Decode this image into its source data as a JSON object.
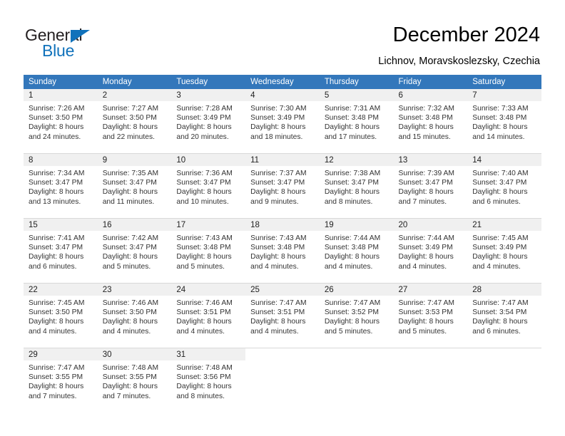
{
  "brand": {
    "name_part1": "General",
    "name_part2": "Blue",
    "triangle_icon": "blue-triangle-icon",
    "accent_color": "#1072bb"
  },
  "header": {
    "title": "December 2024",
    "subtitle": "Lichnov, Moravskoslezsky, Czechia"
  },
  "calendar": {
    "header_bg": "#3377bb",
    "daynum_bg": "#f0f0f0",
    "weekdays": [
      "Sunday",
      "Monday",
      "Tuesday",
      "Wednesday",
      "Thursday",
      "Friday",
      "Saturday"
    ],
    "weeks": [
      [
        {
          "day": "1",
          "sunrise": "Sunrise: 7:26 AM",
          "sunset": "Sunset: 3:50 PM",
          "daylight1": "Daylight: 8 hours",
          "daylight2": "and 24 minutes."
        },
        {
          "day": "2",
          "sunrise": "Sunrise: 7:27 AM",
          "sunset": "Sunset: 3:50 PM",
          "daylight1": "Daylight: 8 hours",
          "daylight2": "and 22 minutes."
        },
        {
          "day": "3",
          "sunrise": "Sunrise: 7:28 AM",
          "sunset": "Sunset: 3:49 PM",
          "daylight1": "Daylight: 8 hours",
          "daylight2": "and 20 minutes."
        },
        {
          "day": "4",
          "sunrise": "Sunrise: 7:30 AM",
          "sunset": "Sunset: 3:49 PM",
          "daylight1": "Daylight: 8 hours",
          "daylight2": "and 18 minutes."
        },
        {
          "day": "5",
          "sunrise": "Sunrise: 7:31 AM",
          "sunset": "Sunset: 3:48 PM",
          "daylight1": "Daylight: 8 hours",
          "daylight2": "and 17 minutes."
        },
        {
          "day": "6",
          "sunrise": "Sunrise: 7:32 AM",
          "sunset": "Sunset: 3:48 PM",
          "daylight1": "Daylight: 8 hours",
          "daylight2": "and 15 minutes."
        },
        {
          "day": "7",
          "sunrise": "Sunrise: 7:33 AM",
          "sunset": "Sunset: 3:48 PM",
          "daylight1": "Daylight: 8 hours",
          "daylight2": "and 14 minutes."
        }
      ],
      [
        {
          "day": "8",
          "sunrise": "Sunrise: 7:34 AM",
          "sunset": "Sunset: 3:47 PM",
          "daylight1": "Daylight: 8 hours",
          "daylight2": "and 13 minutes."
        },
        {
          "day": "9",
          "sunrise": "Sunrise: 7:35 AM",
          "sunset": "Sunset: 3:47 PM",
          "daylight1": "Daylight: 8 hours",
          "daylight2": "and 11 minutes."
        },
        {
          "day": "10",
          "sunrise": "Sunrise: 7:36 AM",
          "sunset": "Sunset: 3:47 PM",
          "daylight1": "Daylight: 8 hours",
          "daylight2": "and 10 minutes."
        },
        {
          "day": "11",
          "sunrise": "Sunrise: 7:37 AM",
          "sunset": "Sunset: 3:47 PM",
          "daylight1": "Daylight: 8 hours",
          "daylight2": "and 9 minutes."
        },
        {
          "day": "12",
          "sunrise": "Sunrise: 7:38 AM",
          "sunset": "Sunset: 3:47 PM",
          "daylight1": "Daylight: 8 hours",
          "daylight2": "and 8 minutes."
        },
        {
          "day": "13",
          "sunrise": "Sunrise: 7:39 AM",
          "sunset": "Sunset: 3:47 PM",
          "daylight1": "Daylight: 8 hours",
          "daylight2": "and 7 minutes."
        },
        {
          "day": "14",
          "sunrise": "Sunrise: 7:40 AM",
          "sunset": "Sunset: 3:47 PM",
          "daylight1": "Daylight: 8 hours",
          "daylight2": "and 6 minutes."
        }
      ],
      [
        {
          "day": "15",
          "sunrise": "Sunrise: 7:41 AM",
          "sunset": "Sunset: 3:47 PM",
          "daylight1": "Daylight: 8 hours",
          "daylight2": "and 6 minutes."
        },
        {
          "day": "16",
          "sunrise": "Sunrise: 7:42 AM",
          "sunset": "Sunset: 3:47 PM",
          "daylight1": "Daylight: 8 hours",
          "daylight2": "and 5 minutes."
        },
        {
          "day": "17",
          "sunrise": "Sunrise: 7:43 AM",
          "sunset": "Sunset: 3:48 PM",
          "daylight1": "Daylight: 8 hours",
          "daylight2": "and 5 minutes."
        },
        {
          "day": "18",
          "sunrise": "Sunrise: 7:43 AM",
          "sunset": "Sunset: 3:48 PM",
          "daylight1": "Daylight: 8 hours",
          "daylight2": "and 4 minutes."
        },
        {
          "day": "19",
          "sunrise": "Sunrise: 7:44 AM",
          "sunset": "Sunset: 3:48 PM",
          "daylight1": "Daylight: 8 hours",
          "daylight2": "and 4 minutes."
        },
        {
          "day": "20",
          "sunrise": "Sunrise: 7:44 AM",
          "sunset": "Sunset: 3:49 PM",
          "daylight1": "Daylight: 8 hours",
          "daylight2": "and 4 minutes."
        },
        {
          "day": "21",
          "sunrise": "Sunrise: 7:45 AM",
          "sunset": "Sunset: 3:49 PM",
          "daylight1": "Daylight: 8 hours",
          "daylight2": "and 4 minutes."
        }
      ],
      [
        {
          "day": "22",
          "sunrise": "Sunrise: 7:45 AM",
          "sunset": "Sunset: 3:50 PM",
          "daylight1": "Daylight: 8 hours",
          "daylight2": "and 4 minutes."
        },
        {
          "day": "23",
          "sunrise": "Sunrise: 7:46 AM",
          "sunset": "Sunset: 3:50 PM",
          "daylight1": "Daylight: 8 hours",
          "daylight2": "and 4 minutes."
        },
        {
          "day": "24",
          "sunrise": "Sunrise: 7:46 AM",
          "sunset": "Sunset: 3:51 PM",
          "daylight1": "Daylight: 8 hours",
          "daylight2": "and 4 minutes."
        },
        {
          "day": "25",
          "sunrise": "Sunrise: 7:47 AM",
          "sunset": "Sunset: 3:51 PM",
          "daylight1": "Daylight: 8 hours",
          "daylight2": "and 4 minutes."
        },
        {
          "day": "26",
          "sunrise": "Sunrise: 7:47 AM",
          "sunset": "Sunset: 3:52 PM",
          "daylight1": "Daylight: 8 hours",
          "daylight2": "and 5 minutes."
        },
        {
          "day": "27",
          "sunrise": "Sunrise: 7:47 AM",
          "sunset": "Sunset: 3:53 PM",
          "daylight1": "Daylight: 8 hours",
          "daylight2": "and 5 minutes."
        },
        {
          "day": "28",
          "sunrise": "Sunrise: 7:47 AM",
          "sunset": "Sunset: 3:54 PM",
          "daylight1": "Daylight: 8 hours",
          "daylight2": "and 6 minutes."
        }
      ],
      [
        {
          "day": "29",
          "sunrise": "Sunrise: 7:47 AM",
          "sunset": "Sunset: 3:55 PM",
          "daylight1": "Daylight: 8 hours",
          "daylight2": "and 7 minutes."
        },
        {
          "day": "30",
          "sunrise": "Sunrise: 7:48 AM",
          "sunset": "Sunset: 3:55 PM",
          "daylight1": "Daylight: 8 hours",
          "daylight2": "and 7 minutes."
        },
        {
          "day": "31",
          "sunrise": "Sunrise: 7:48 AM",
          "sunset": "Sunset: 3:56 PM",
          "daylight1": "Daylight: 8 hours",
          "daylight2": "and 8 minutes."
        },
        {
          "day": "",
          "sunrise": "",
          "sunset": "",
          "daylight1": "",
          "daylight2": ""
        },
        {
          "day": "",
          "sunrise": "",
          "sunset": "",
          "daylight1": "",
          "daylight2": ""
        },
        {
          "day": "",
          "sunrise": "",
          "sunset": "",
          "daylight1": "",
          "daylight2": ""
        },
        {
          "day": "",
          "sunrise": "",
          "sunset": "",
          "daylight1": "",
          "daylight2": ""
        }
      ]
    ]
  }
}
